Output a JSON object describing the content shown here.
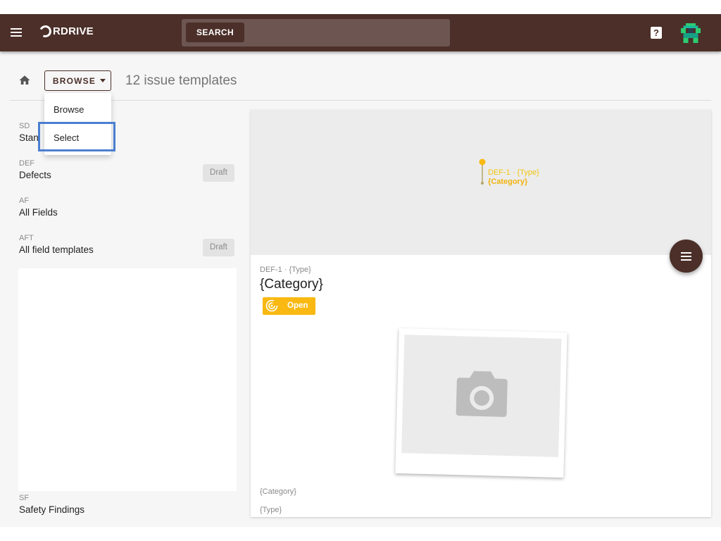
{
  "topbar": {
    "logo_text": "RDRIVE",
    "search_button_label": "SEARCH",
    "search_value": "",
    "help_icon": "question-icon",
    "avatar_icon": "pixel-avatar",
    "brand_color": "#4b2f28"
  },
  "toolbar": {
    "browse_label": "BROWSE",
    "title": "12 issue templates"
  },
  "dropdown": {
    "items": [
      "Browse",
      "Select"
    ],
    "selected": "Select"
  },
  "templates": [
    {
      "code": "SD",
      "name": "Stan",
      "draft": ""
    },
    {
      "code": "DEF",
      "name": "Defects",
      "draft": "Draft"
    },
    {
      "code": "AF",
      "name": "All Fields",
      "draft": ""
    },
    {
      "code": "AFT",
      "name": "All field templates",
      "draft": "Draft"
    },
    {
      "code": "SF",
      "name": "Safety Findings",
      "draft": ""
    }
  ],
  "preview": {
    "map_label_ref": "DEF-1 · {Type}",
    "map_label_category": "{Category}",
    "ref": "DEF-1 · {Type}",
    "title": "{Category}",
    "status": "Open",
    "status_color": "#f9b912",
    "photo_placeholder_icon": "camera-icon",
    "field_1": "{Category}",
    "field_2": "{Type}"
  }
}
